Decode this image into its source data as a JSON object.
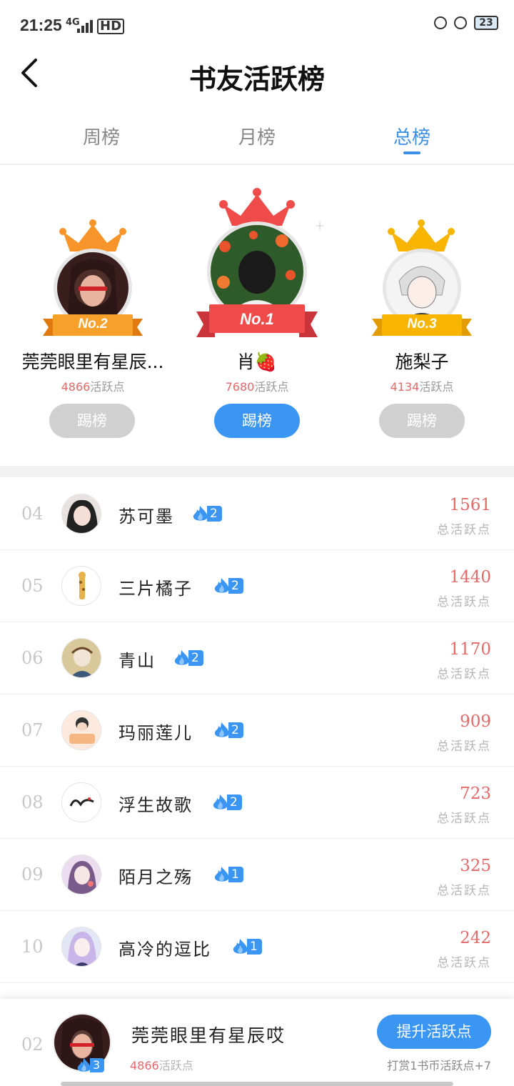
{
  "status_bar": {
    "time": "21:25",
    "network": "4G",
    "hd": "HD",
    "battery": "23"
  },
  "header": {
    "title": "书友活跃榜"
  },
  "tabs": [
    {
      "label": "周榜",
      "active": false
    },
    {
      "label": "月榜",
      "active": false
    },
    {
      "label": "总榜",
      "active": true
    }
  ],
  "podium": {
    "first": {
      "rank_label": "No.1",
      "name": "肖🍓",
      "points": "7680",
      "points_unit": "活跃点",
      "button": "踢榜"
    },
    "second": {
      "rank_label": "No.2",
      "name": "莞莞眼里有星辰...",
      "points": "4866",
      "points_unit": "活跃点",
      "button": "踢榜"
    },
    "third": {
      "rank_label": "No.3",
      "name": "施梨子",
      "points": "4134",
      "points_unit": "活跃点",
      "button": "踢榜"
    }
  },
  "list": [
    {
      "rank": "04",
      "name": "苏可墨",
      "level": "2",
      "points": "1561",
      "label": "总活跃点"
    },
    {
      "rank": "05",
      "name": "三片橘子",
      "level": "2",
      "points": "1440",
      "label": "总活跃点"
    },
    {
      "rank": "06",
      "name": "青山",
      "level": "2",
      "points": "1170",
      "label": "总活跃点"
    },
    {
      "rank": "07",
      "name": "玛丽莲儿",
      "level": "2",
      "points": "909",
      "label": "总活跃点"
    },
    {
      "rank": "08",
      "name": "浮生故歌",
      "level": "2",
      "points": "723",
      "label": "总活跃点"
    },
    {
      "rank": "09",
      "name": "陌月之殇",
      "level": "1",
      "points": "325",
      "label": "总活跃点"
    },
    {
      "rank": "10",
      "name": "高冷的逗比",
      "level": "1",
      "points": "242",
      "label": "总活跃点"
    }
  ],
  "me": {
    "rank": "02",
    "name": "莞莞眼里有星辰哎",
    "level": "3",
    "points": "4866",
    "points_unit": "活跃点",
    "button": "提升活跃点",
    "hint": "打赏1书币活跃点+7"
  },
  "colors": {
    "accent": "#3a96f2",
    "points": "#e46a6a",
    "crown_red": "#ef4b4b",
    "crown_orange": "#f7952a",
    "crown_gold": "#f7b500"
  }
}
